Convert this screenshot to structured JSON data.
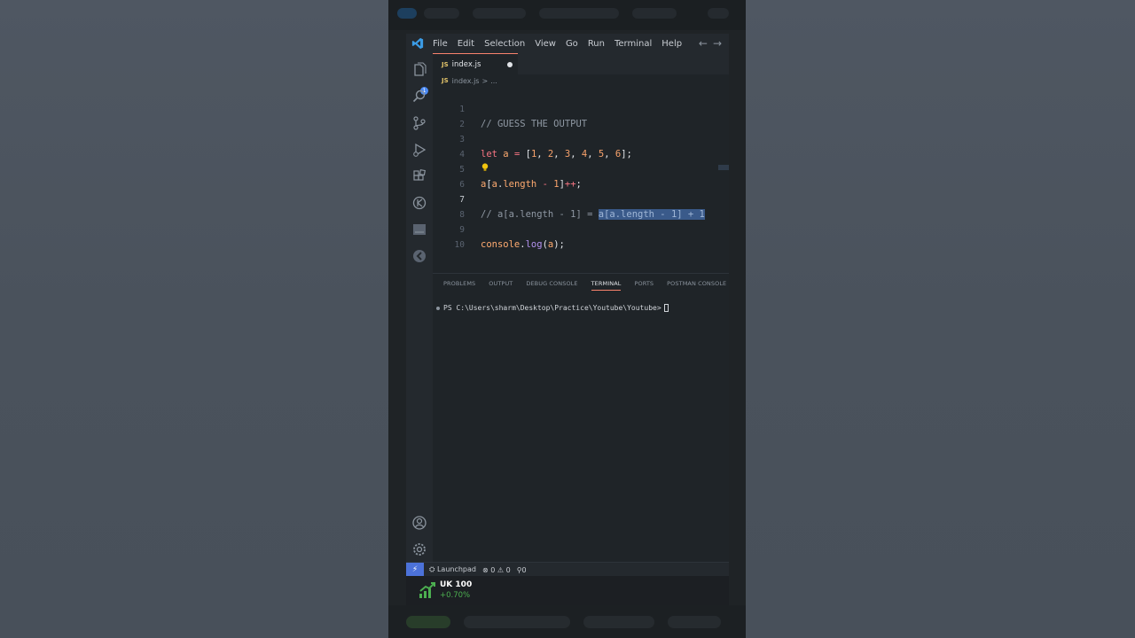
{
  "menu": [
    "File",
    "Edit",
    "Selection",
    "View",
    "Go",
    "Run",
    "Terminal",
    "Help"
  ],
  "nav": {
    "back": "←",
    "forward": "→"
  },
  "activity_badge": "1",
  "tab": {
    "lang": "JS",
    "name": "index.js"
  },
  "breadcrumb": {
    "lang": "JS",
    "file": "index.js",
    "sep": ">",
    "rest": "..."
  },
  "editor": {
    "active_line": 7,
    "line_numbers": [
      "1",
      "2",
      "3",
      "4",
      "5",
      "6",
      "7",
      "8",
      "9",
      "10"
    ],
    "lines": [
      "// GUESS THE OUTPUT",
      "",
      "let a = [1, 2, 3, 4, 5, 6];",
      "",
      "a[a.length - 1]++;",
      "",
      "// a[a.length - 1] = a[a.length - 1] + 1",
      "",
      "console.log(a);",
      ""
    ]
  },
  "panel": {
    "tabs": [
      "PROBLEMS",
      "OUTPUT",
      "DEBUG CONSOLE",
      "TERMINAL",
      "PORTS",
      "POSTMAN CONSOLE"
    ],
    "active_tab": "TERMINAL",
    "terminal_prompt": "PS C:\\Users\\sharm\\Desktop\\Practice\\Youtube\\Youtube>"
  },
  "status": {
    "remote": "⚡",
    "launchpad": "Launchpad",
    "errors": "0",
    "warnings": "0",
    "ports": "0"
  },
  "ticker": {
    "name": "UK 100",
    "change": "+0.70%"
  },
  "colors": {
    "accent": "#f9826c",
    "remote_bg": "#4c72d9",
    "ticker_up": "#4caf50"
  }
}
